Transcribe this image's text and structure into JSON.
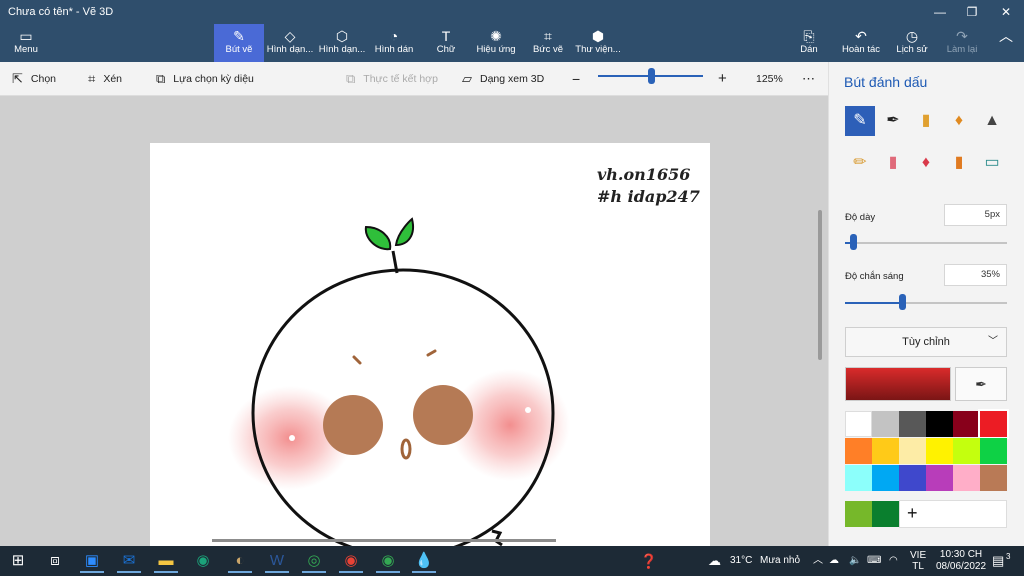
{
  "window": {
    "title": "Chưa có tên* - Vẽ 3D",
    "minimize": "—",
    "restore": "❐",
    "close": "✕"
  },
  "ribbon": {
    "menu": "Menu",
    "tools": [
      {
        "label": "Bút vẽ",
        "icon": "brush-icon",
        "glyph": "✎"
      },
      {
        "label": "Hình dạn...",
        "icon": "2d-shapes-icon",
        "glyph": "◇"
      },
      {
        "label": "Hình dạn...",
        "icon": "3d-shapes-icon",
        "glyph": "⬡"
      },
      {
        "label": "Hình dán",
        "icon": "stickers-icon",
        "glyph": "◔"
      },
      {
        "label": "Chữ",
        "icon": "text-icon",
        "glyph": "T"
      },
      {
        "label": "Hiệu ứng",
        "icon": "effects-icon",
        "glyph": "✺"
      },
      {
        "label": "Bức vẽ",
        "icon": "canvas-icon",
        "glyph": "⌗"
      },
      {
        "label": "Thư viện...",
        "icon": "3d-library-icon",
        "glyph": "⬢"
      }
    ],
    "paste": "Dán",
    "undo": "Hoàn tác",
    "history": "Lịch sử",
    "redo": "Làm lại"
  },
  "commandbar": {
    "select": "Chọn",
    "crop": "Xén",
    "magic_select": "Lựa chọn kỳ diệu",
    "mixed_reality": "Thực tế kết hợp",
    "view_3d": "Dạng xem 3D",
    "zoom_out": "−",
    "zoom_in": "+",
    "zoom_level": "125%",
    "zoom_fraction": 0.5,
    "more": "⋯"
  },
  "canvas": {
    "watermark_line1": "vh.on1656",
    "watermark_line2": "#h idap247"
  },
  "panel": {
    "title": "Bút đánh dấu",
    "brushes": [
      {
        "icon": "marker-brush-icon",
        "active": true
      },
      {
        "icon": "calligraphy-pen-icon",
        "active": false
      },
      {
        "icon": "oil-brush-icon",
        "active": false
      },
      {
        "icon": "watercolor-brush-icon",
        "active": false
      },
      {
        "icon": "pixel-pen-icon",
        "active": false
      },
      {
        "icon": "pencil-icon",
        "active": false
      },
      {
        "icon": "eraser-icon",
        "active": false
      },
      {
        "icon": "crayon-icon",
        "active": false
      },
      {
        "icon": "spray-can-icon",
        "active": false
      },
      {
        "icon": "fill-bucket-icon",
        "active": false
      }
    ],
    "thickness_label": "Độ dày",
    "thickness_value": "5px",
    "thickness_fraction": 0.05,
    "opacity_label": "Độ chắn sáng",
    "opacity_value": "35%",
    "opacity_fraction": 0.35,
    "finish_dropdown": "Tùy chỉnh",
    "current_color": "#d92b2b",
    "palette": [
      "#ffffff",
      "#c3c3c3",
      "#585858",
      "#000000",
      "#88001b",
      "#ec1c24",
      "#ff7f27",
      "#ffca18",
      "#fdeca6",
      "#fff200",
      "#c4ff0e",
      "#0ed145",
      "#8cfffb",
      "#00a8f3",
      "#3f48cc",
      "#b83dba",
      "#ffaec8",
      "#b97a56"
    ],
    "custom_colors": [
      "#76b82a",
      "#0a7f2e"
    ],
    "add_color": "+"
  },
  "taskbar": {
    "apps": [
      {
        "icon": "windows-start-icon",
        "color": "#ffffff"
      },
      {
        "icon": "task-view-icon",
        "color": "#ffffff"
      },
      {
        "icon": "zoom-app-icon",
        "color": "#2d8cff"
      },
      {
        "icon": "mail-icon",
        "color": "#1a73d9"
      },
      {
        "icon": "file-explorer-icon",
        "color": "#f4c542"
      },
      {
        "icon": "edge-icon",
        "color": "#1ba37a"
      },
      {
        "icon": "paint-icon",
        "color": "#c9a56a"
      },
      {
        "icon": "word-icon",
        "color": "#2b579a"
      },
      {
        "icon": "chrome-alt-icon",
        "color": "#34a853"
      },
      {
        "icon": "chrome-icon",
        "color": "#e94235"
      },
      {
        "icon": "chrome-profile-icon",
        "color": "#34a853"
      },
      {
        "icon": "paint-3d-icon",
        "color": "#7a5cff"
      }
    ],
    "weather_temp": "31°C",
    "weather_text": "Mưa nhỏ",
    "lang_line1": "VIE",
    "lang_line2": "TL",
    "time": "10:30 CH",
    "date": "08/06/2022",
    "notification_count": "3"
  }
}
